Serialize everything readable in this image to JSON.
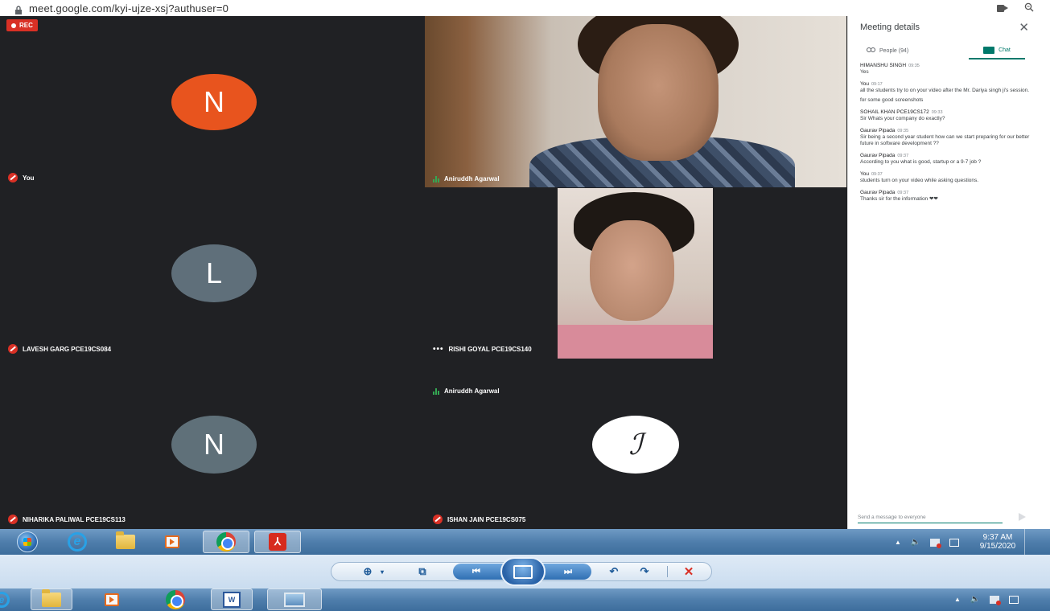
{
  "browser": {
    "url": "meet.google.com/kyi-ujze-xsj?authuser=0"
  },
  "meeting": {
    "rec_label": "REC",
    "tiles": [
      {
        "name": "You",
        "avatar_letter": "N",
        "avatar_color": "#e8541e",
        "muted": true
      },
      {
        "name": "Aniruddh Agarwal",
        "video": true,
        "speaking": true
      },
      {
        "name": "LAVESH GARG PCE19CS084",
        "avatar_letter": "L",
        "avatar_color": "#5f6f7a",
        "muted": true
      },
      {
        "name": "RISHI GOYAL PCE19CS140",
        "video": true
      },
      {
        "name": "NIHARIKA PALIWAL PCE19CS113",
        "avatar_letter": "N",
        "avatar_color": "#5f7079",
        "muted": true
      },
      {
        "name": "ISHAN JAIN PCE19CS075",
        "avatar_letter": "ℐ",
        "avatar_color": "#ffffff",
        "muted": true
      }
    ]
  },
  "panel": {
    "title": "Meeting details",
    "tabs": {
      "people": "People (94)",
      "chat": "Chat"
    },
    "messages": [
      {
        "sender": "HIMANSHU SINGH",
        "time": "09:35",
        "lines": [
          "Yes"
        ]
      },
      {
        "sender": "You",
        "time": "09:17",
        "lines": [
          "all the students try to  on your video after the Mr. Dariya singh  ji's session."
        ],
        "extra": "for some good screenshots"
      },
      {
        "sender": "SOHAIL KHAN PCE19CS172",
        "time": "09:33",
        "lines": [
          "Sir Whats your company do exactly?"
        ]
      },
      {
        "sender": "Gaurav Pipada",
        "time": "09:35",
        "lines": [
          "Sir being a second year student how can we start preparing for our better future in software development ??"
        ]
      },
      {
        "sender": "Gaurav Pipada",
        "time": "09:37",
        "lines": [
          "According to you what is good, startup or a 9-7 job ?"
        ]
      },
      {
        "sender": "You",
        "time": "09:37",
        "lines": [
          "students turn on your video while asking questions."
        ]
      },
      {
        "sender": "Gaurav Pipada",
        "time": "09:37",
        "lines": [
          "Thanks sir for the information ❤❤"
        ]
      }
    ],
    "compose_placeholder": "Send a message to everyone"
  },
  "taskbar": {
    "clock_time": "9:37 AM",
    "clock_date": "9/15/2020",
    "tray_arrow": "▲",
    "volume": "🔈"
  },
  "viewer": {
    "zoom": "⊕",
    "zoom_caret": "▾",
    "fit": "⧉",
    "prev": "⏮",
    "next": "⏭",
    "rotate_left": "↶",
    "rotate_right": "↷",
    "delete": "✕"
  }
}
